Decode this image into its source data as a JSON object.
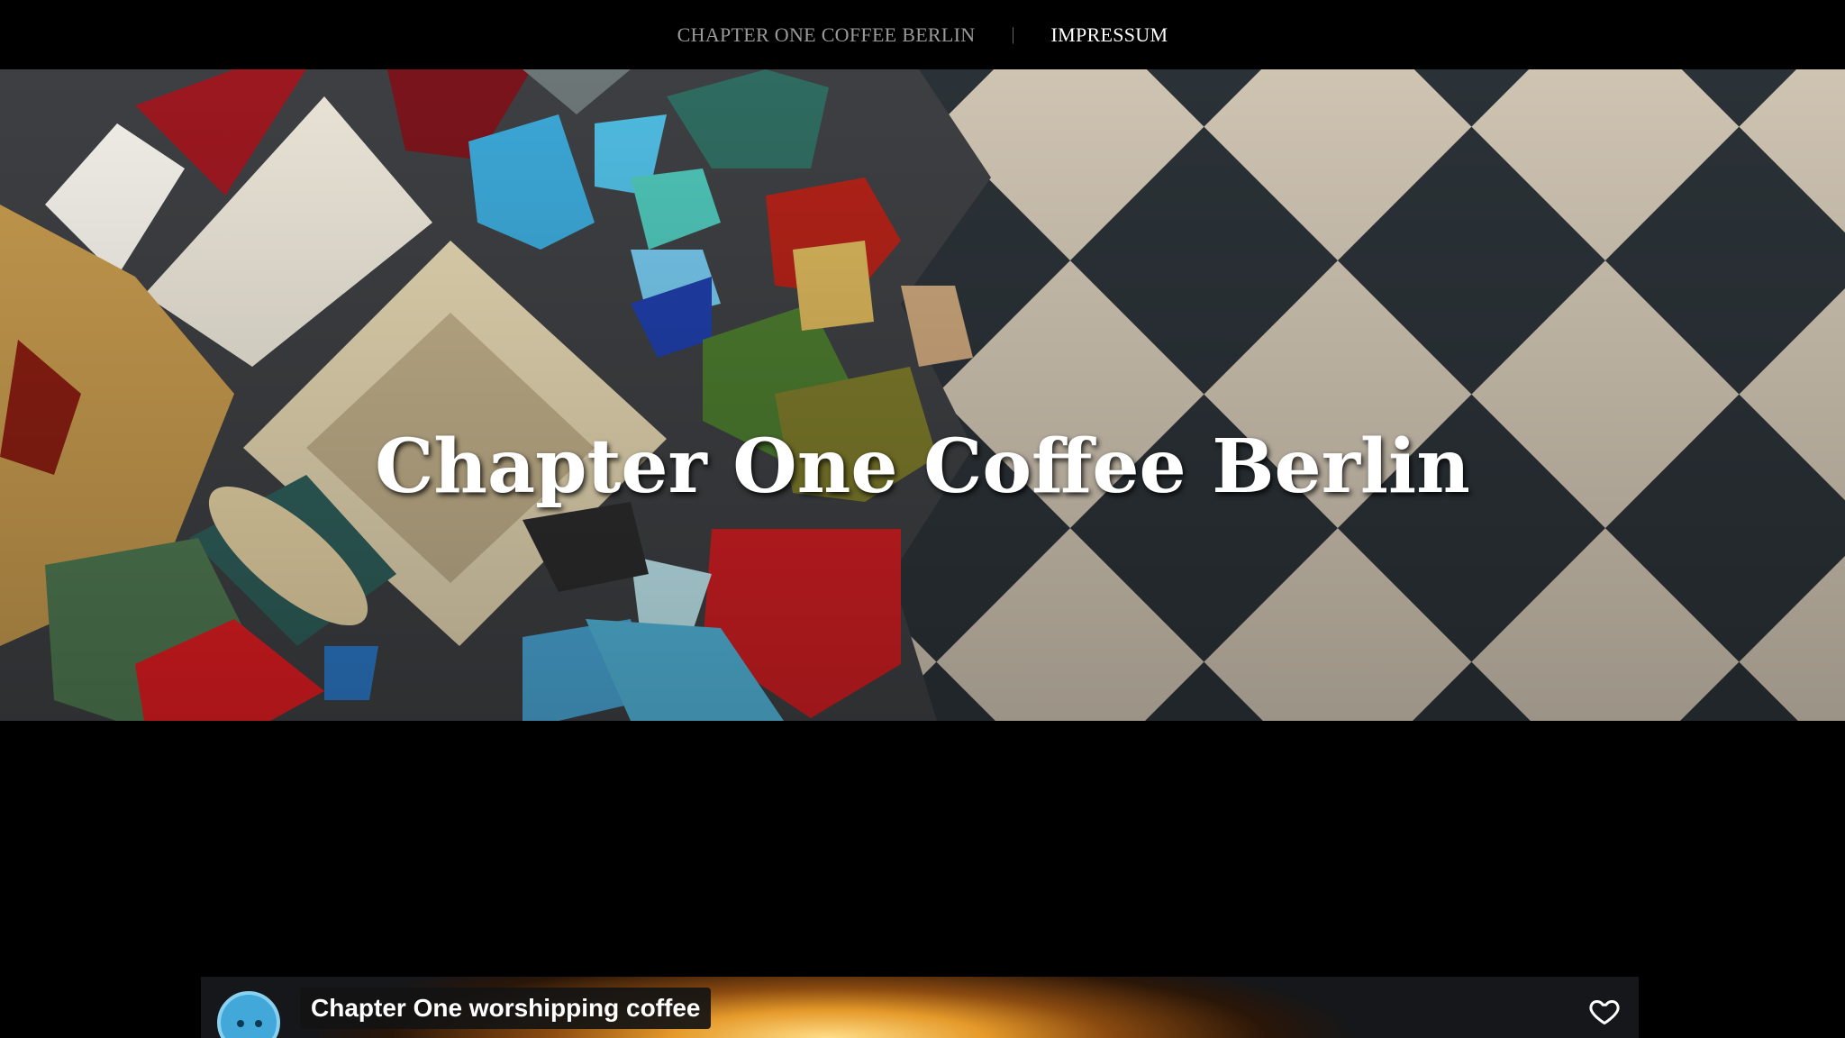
{
  "nav": {
    "items": [
      {
        "label": "CHAPTER ONE COFFEE BERLIN"
      },
      {
        "label": "IMPRESSUM"
      }
    ],
    "separator": "|"
  },
  "hero": {
    "title": "Chapter One Coffee Berlin",
    "image": "mosaic-tile-floor"
  },
  "video": {
    "title": "Chapter One worshipping coffee",
    "avatar_icon": "channel-avatar-icon",
    "like_icon": "heart-icon"
  }
}
